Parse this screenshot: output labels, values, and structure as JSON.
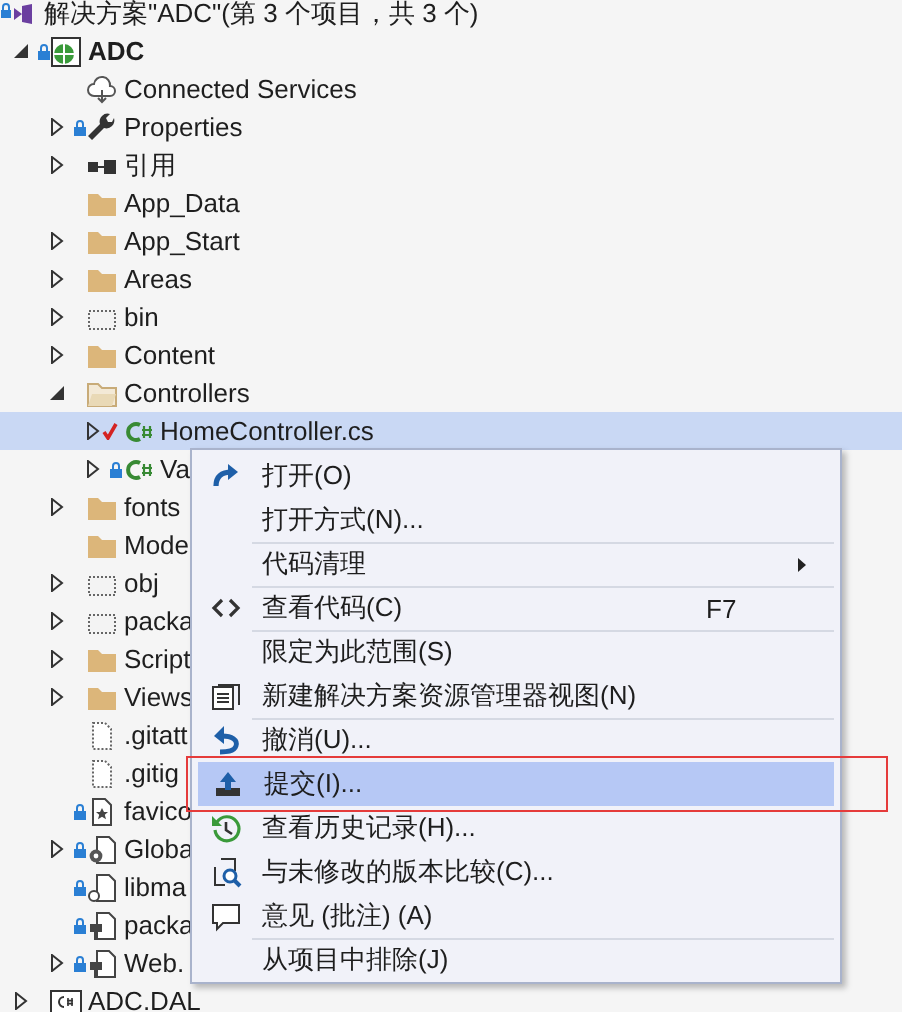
{
  "solution": {
    "title": "解决方案\"ADC\"(第 3 个项目，共 3 个)"
  },
  "tree": [
    {
      "label": "ADC",
      "kind": "web-project",
      "locked": true,
      "modified": false,
      "startup": true,
      "expanded": true,
      "selected": false,
      "children": [
        {
          "label": "Connected Services",
          "kind": "cloud",
          "locked": false,
          "modified": false,
          "selected": false
        },
        {
          "label": "Properties",
          "kind": "wrench",
          "locked": true,
          "modified": false,
          "expanded": false,
          "selected": false
        },
        {
          "label": "引用",
          "kind": "reference",
          "locked": false,
          "modified": false,
          "expanded": false,
          "selected": false
        },
        {
          "label": "App_Data",
          "kind": "folder",
          "locked": false,
          "modified": false,
          "selected": false
        },
        {
          "label": "App_Start",
          "kind": "folder",
          "locked": false,
          "modified": false,
          "expanded": false,
          "selected": false
        },
        {
          "label": "Areas",
          "kind": "folder",
          "locked": false,
          "modified": false,
          "expanded": false,
          "selected": false
        },
        {
          "label": "bin",
          "kind": "hidden-folder",
          "locked": false,
          "modified": false,
          "expanded": false,
          "selected": false
        },
        {
          "label": "Content",
          "kind": "folder",
          "locked": false,
          "modified": false,
          "expanded": false,
          "selected": false
        },
        {
          "label": "Controllers",
          "kind": "open-folder",
          "locked": false,
          "modified": false,
          "expanded": true,
          "selected": false,
          "children": [
            {
              "label": "HomeController.cs",
              "kind": "csharp",
              "locked": false,
              "modified": true,
              "expanded": false,
              "selected": true
            },
            {
              "label": "Va",
              "kind": "csharp",
              "locked": true,
              "modified": false,
              "expanded": false,
              "selected": false
            }
          ]
        },
        {
          "label": "fonts",
          "kind": "folder",
          "locked": false,
          "modified": false,
          "expanded": false,
          "selected": false
        },
        {
          "label": "Mode",
          "kind": "folder",
          "locked": false,
          "modified": false,
          "selected": false
        },
        {
          "label": "obj",
          "kind": "hidden-folder",
          "locked": false,
          "modified": false,
          "expanded": false,
          "selected": false
        },
        {
          "label": "packa",
          "kind": "hidden-folder",
          "locked": false,
          "modified": false,
          "expanded": false,
          "selected": false
        },
        {
          "label": "Script",
          "kind": "folder",
          "locked": false,
          "modified": false,
          "expanded": false,
          "selected": false
        },
        {
          "label": "Views",
          "kind": "folder",
          "locked": false,
          "modified": false,
          "expanded": false,
          "selected": false
        },
        {
          "label": ".gitatt",
          "kind": "hidden-file",
          "locked": false,
          "modified": false,
          "selected": false
        },
        {
          "label": ".gitig",
          "kind": "hidden-file",
          "locked": false,
          "modified": false,
          "selected": false
        },
        {
          "label": "favico",
          "kind": "image-file",
          "locked": true,
          "modified": false,
          "selected": false
        },
        {
          "label": "Globa",
          "kind": "gear-file",
          "locked": true,
          "modified": false,
          "expanded": false,
          "selected": false
        },
        {
          "label": "libma",
          "kind": "link-file",
          "locked": true,
          "modified": false,
          "selected": false
        },
        {
          "label": "packa",
          "kind": "config-file",
          "locked": true,
          "modified": false,
          "selected": false
        },
        {
          "label": "Web.",
          "kind": "config-file",
          "locked": true,
          "modified": false,
          "expanded": false,
          "selected": false
        }
      ]
    },
    {
      "label": "ADC.DAL",
      "kind": "csharp-project",
      "locked": false,
      "modified": false,
      "startup": false,
      "expanded": false,
      "selected": false
    }
  ],
  "context_menu": {
    "items": [
      {
        "label": "打开(O)",
        "kind": "redo",
        "selected": false
      },
      {
        "label": "打开方式(N)...",
        "selected": false
      },
      {
        "label": "代码清理",
        "separator_before": true,
        "submenu": true,
        "selected": false
      },
      {
        "label": "查看代码(C)",
        "kind": "code",
        "shortcut": "F7",
        "separator_before": true,
        "selected": false
      },
      {
        "label": "限定为此范围(S)",
        "separator_before": true,
        "selected": false
      },
      {
        "label": "新建解决方案资源管理器视图(N)",
        "kind": "window",
        "selected": false
      },
      {
        "label": "撤消(U)...",
        "kind": "undo",
        "separator_before": true,
        "selected": false
      },
      {
        "label": "提交(I)...",
        "kind": "upload",
        "selected": true,
        "annotated": true
      },
      {
        "label": "查看历史记录(H)...",
        "kind": "history",
        "selected": false
      },
      {
        "label": "与未修改的版本比较(C)...",
        "kind": "compare",
        "selected": false
      },
      {
        "label": "意见 (批注) (A)",
        "kind": "comment",
        "selected": false
      },
      {
        "label": "从项目中排除(J)",
        "separator_before": true,
        "selected": false
      }
    ]
  }
}
